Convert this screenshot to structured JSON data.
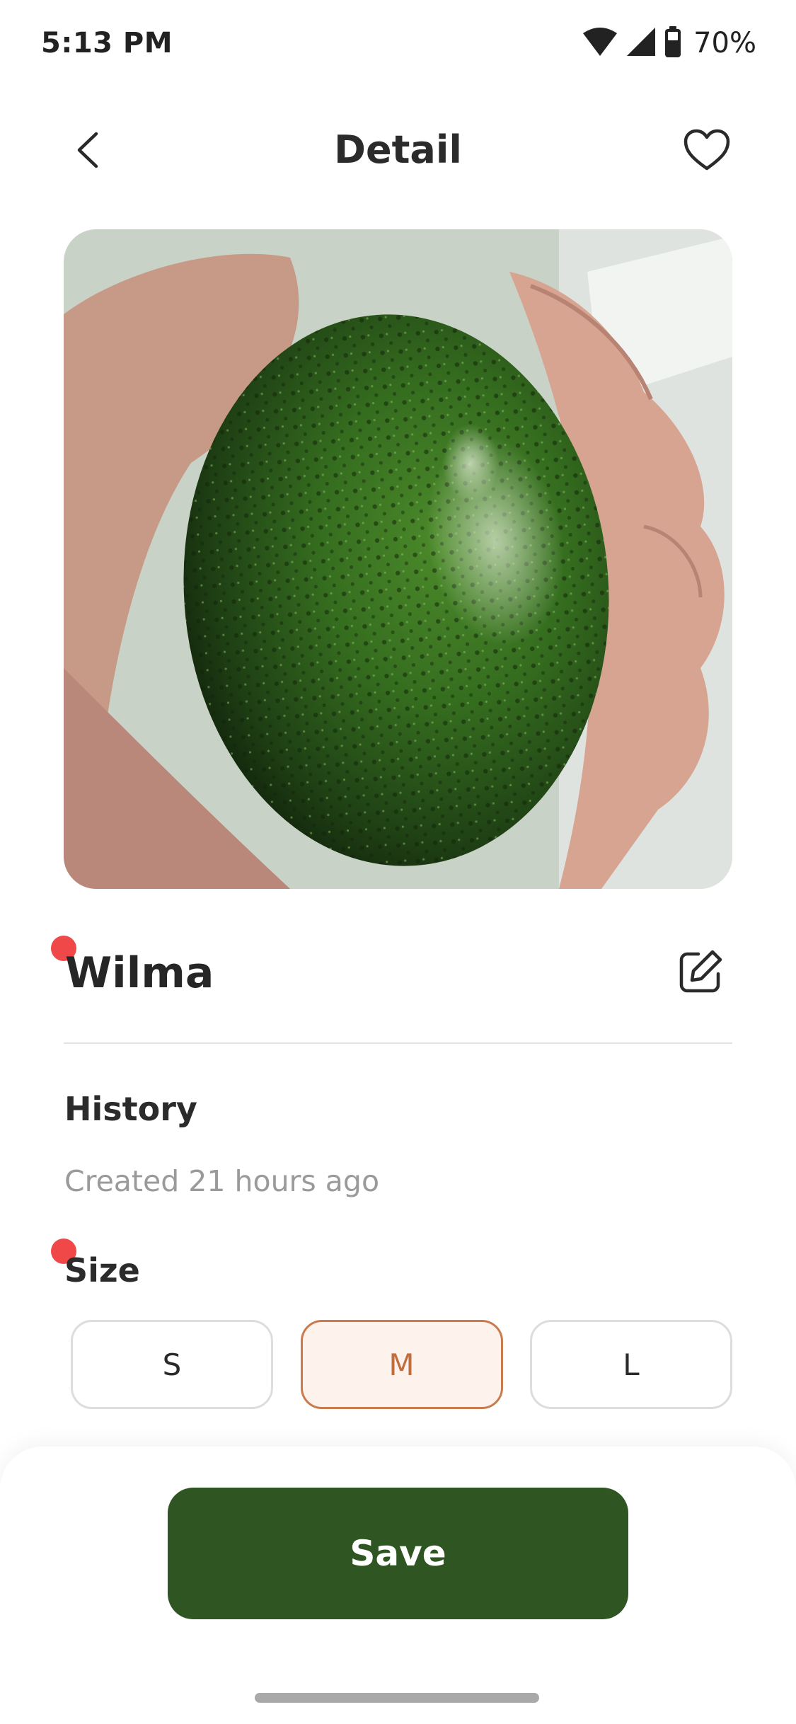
{
  "status_bar": {
    "time": "5:13 PM",
    "battery": "70%",
    "icons": [
      "wifi-icon",
      "cell-signal-icon",
      "battery-icon"
    ]
  },
  "header": {
    "title": "Detail",
    "back_icon": "chevron-left-icon",
    "favorite_icon": "heart-outline-icon"
  },
  "plant": {
    "photo_subject": "avocado",
    "name": "Wilma",
    "edit_icon": "edit-icon"
  },
  "history": {
    "title": "History",
    "created": "Created 21 hours ago"
  },
  "size": {
    "title": "Size",
    "options": [
      "S",
      "M",
      "L"
    ],
    "selected": "M"
  },
  "actions": {
    "save_label": "Save"
  },
  "colors": {
    "primary": "#2f5523",
    "accent": "#c97b4e",
    "accent_bg": "#fdf2ec",
    "alert_dot": "#f04848",
    "muted_text": "#9a9a9a"
  }
}
